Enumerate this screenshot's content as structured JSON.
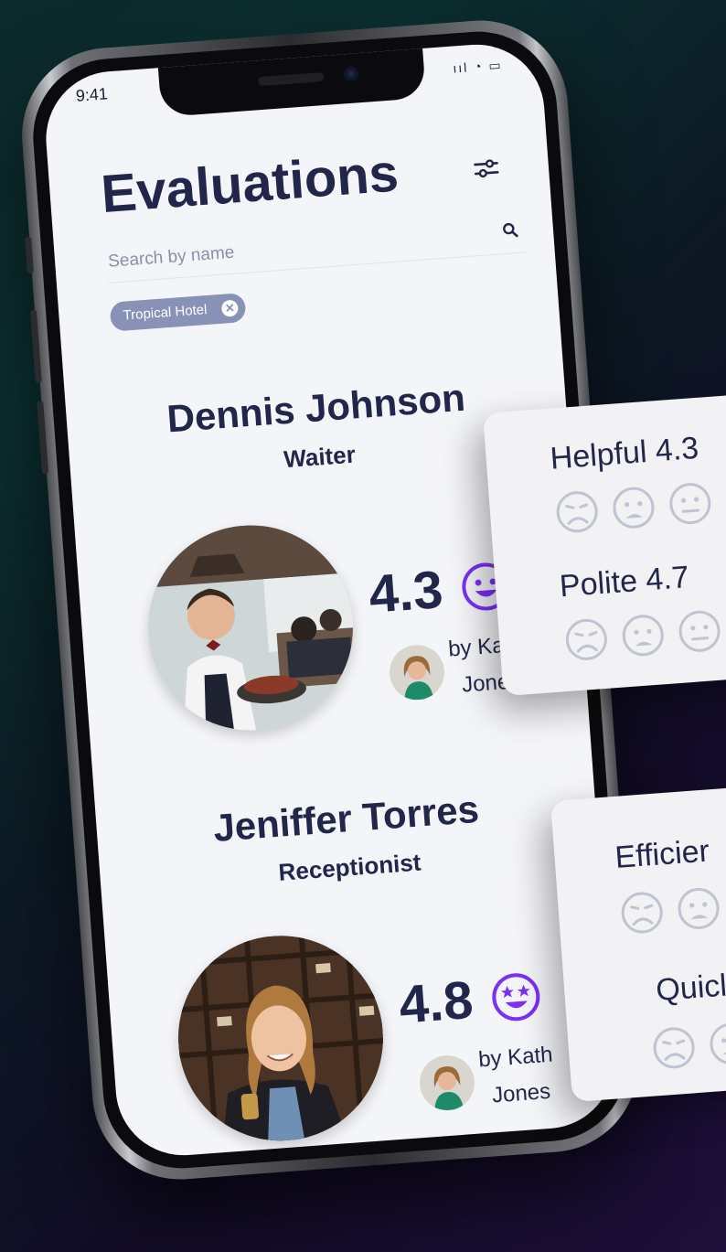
{
  "status": {
    "time": "9:41",
    "icons": "ııl ◔ ▭"
  },
  "page": {
    "title": "Evaluations"
  },
  "search": {
    "placeholder": "Search by name"
  },
  "filter_chip": {
    "label": "Tropical Hotel",
    "close": "✕"
  },
  "employees": [
    {
      "name": "Dennis Johnson",
      "role": "Waiter",
      "score": "4.3",
      "score_emoji": "smiling-face",
      "reviewer_line1": "by Kathr",
      "reviewer_line2": "Jones"
    },
    {
      "name": "Jeniffer Torres",
      "role": "Receptionist",
      "score": "4.8",
      "score_emoji": "star-eyes-face",
      "reviewer_line1": "by Kath",
      "reviewer_line2": "Jones"
    }
  ],
  "panels": [
    {
      "ratings": [
        {
          "label": "Helpful 4.3"
        },
        {
          "label": "Polite 4.7"
        }
      ]
    },
    {
      "ratings": [
        {
          "label": "Efficier"
        },
        {
          "label": "Quicl"
        }
      ]
    }
  ],
  "colors": {
    "text": "#22264a",
    "accent": "#7b2ff7",
    "chip": "#8892b6",
    "face_outline": "#bfc4d2"
  }
}
